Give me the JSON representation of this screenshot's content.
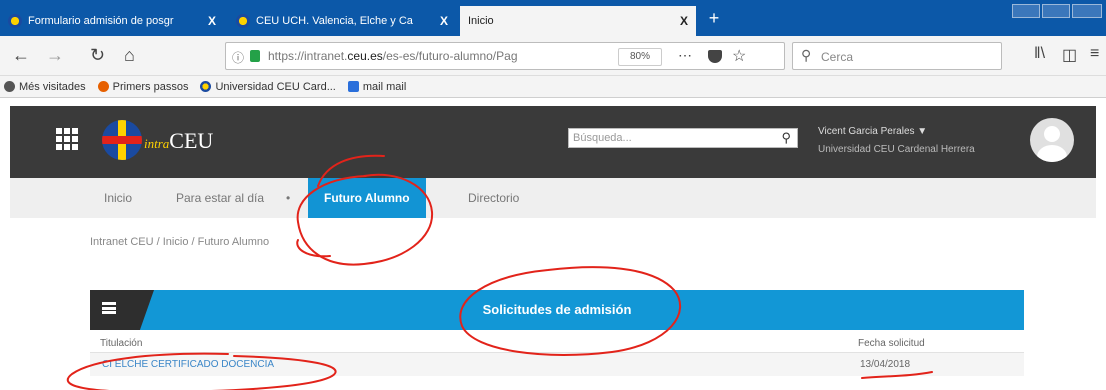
{
  "browser": {
    "tabs": [
      {
        "label": "Formulario admisión de posgr",
        "close": "X"
      },
      {
        "label": "CEU UCH. Valencia, Elche y Ca",
        "close": "X"
      },
      {
        "label": "Inicio",
        "close": "X"
      }
    ],
    "new_tab": "+",
    "url_prefix": "https://intranet.",
    "url_domain": "ceu.es",
    "url_path": "/es-es/futuro-alumno/Pag",
    "zoom": "80%",
    "search_placeholder": "Cerca",
    "bookmarks": [
      {
        "label": "Més visitades",
        "icon": "gear-icon"
      },
      {
        "label": "Primers passos",
        "icon": "firefox-icon"
      },
      {
        "label": "Universidad CEU Card...",
        "icon": "ceu-logo-icon"
      },
      {
        "label": "mail mail",
        "icon": "mail-icon"
      }
    ]
  },
  "site": {
    "brand_prefix": "intra",
    "brand": "CEU",
    "search_placeholder": "Búsqueda...",
    "user_name": "Vicent Garcia Perales ▼",
    "user_org": "Universidad CEU Cardenal Herrera",
    "nav": [
      "Inicio",
      "Para estar al día",
      "Futuro Alumno",
      "Directorio"
    ],
    "breadcrumb": "Intranet CEU / Inicio / Futuro Alumno"
  },
  "panel": {
    "title": "Solicitudes de admisión",
    "col_titulacion": "Titulación",
    "col_fecha": "Fecha solicitud",
    "row_titulacion": "CI ELCHE CERTIFICADO DOCENCIA",
    "row_fecha": "13/04/2018"
  },
  "colors": {
    "accent": "#1297d6",
    "header": "#3a3a3a",
    "annotation": "#e2231a"
  }
}
